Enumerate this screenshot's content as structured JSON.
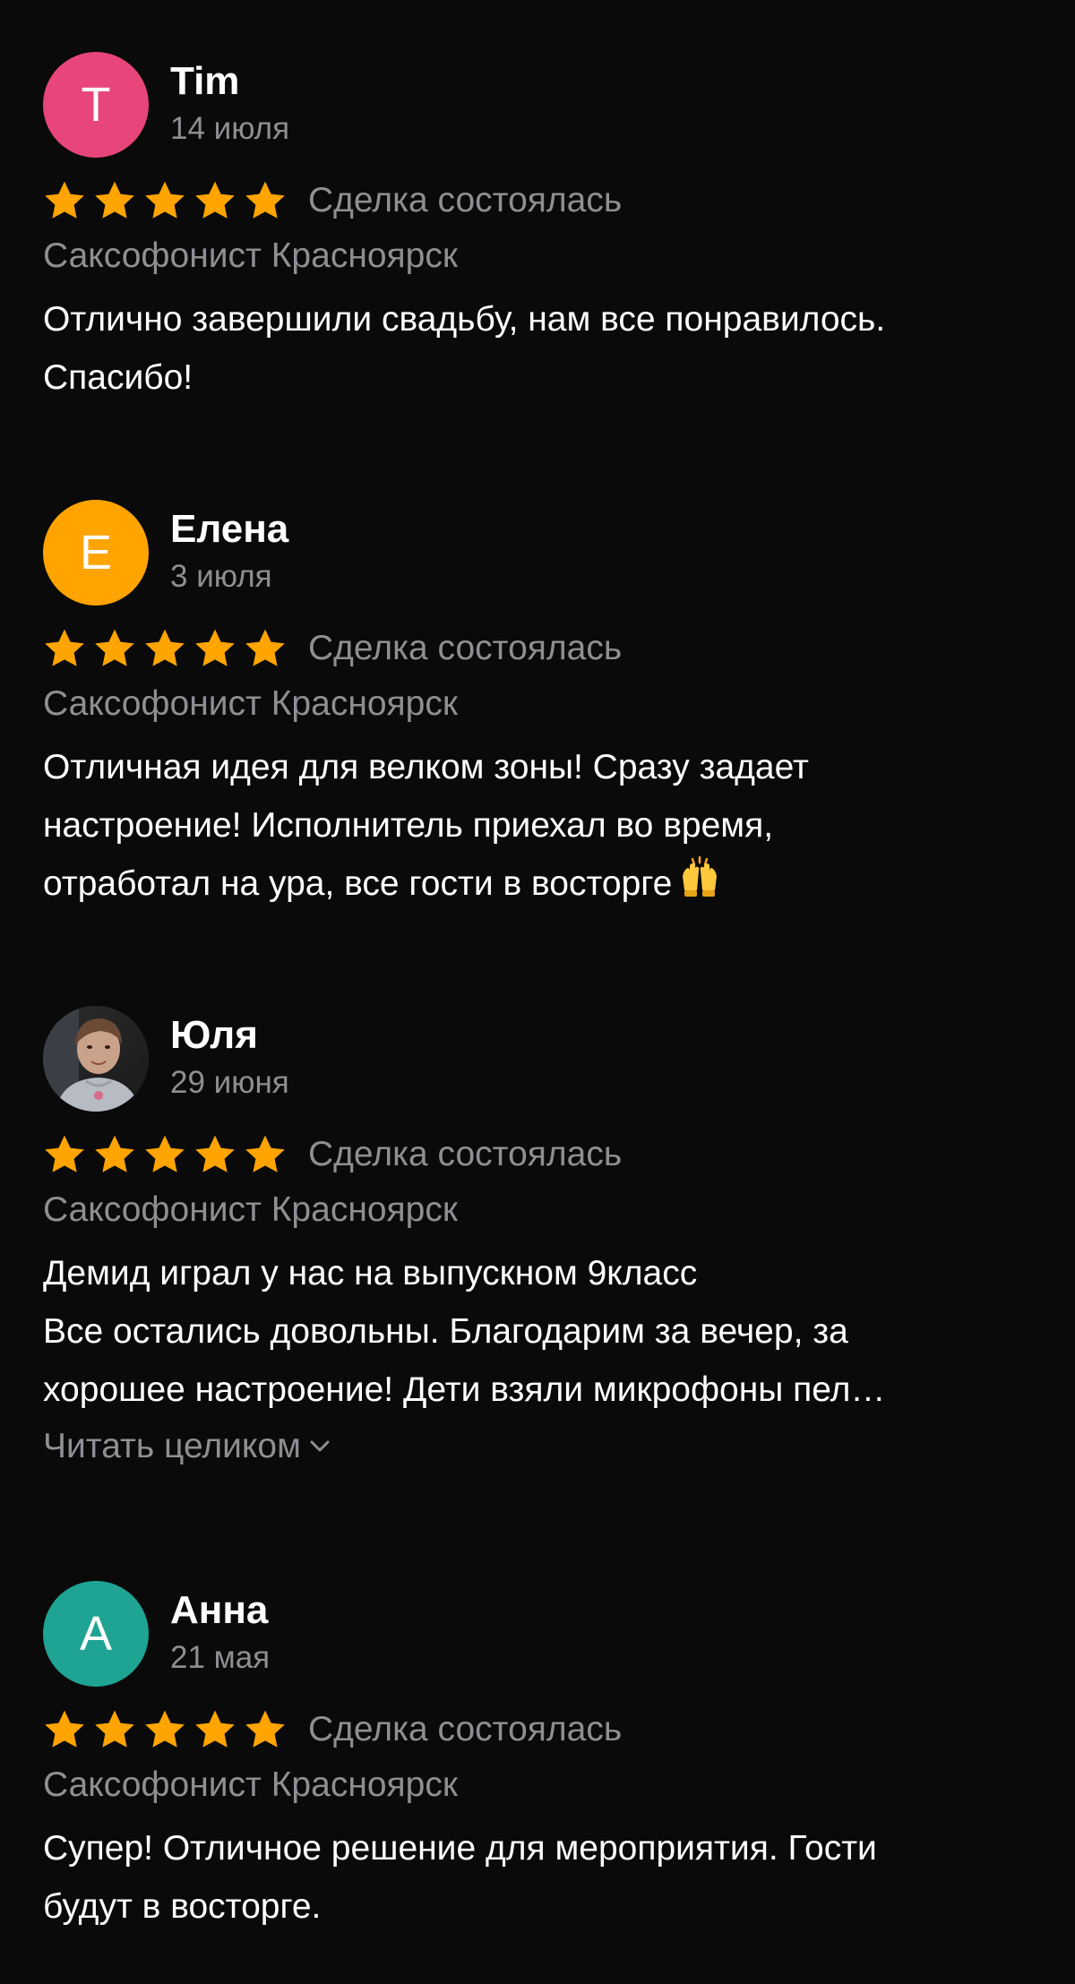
{
  "reviews": [
    {
      "initial": "T",
      "avatar_color": "#e8457a",
      "name": "Tim",
      "date": "14 июля",
      "rating": 5,
      "deal_status": "Сделка состоялась",
      "service": "Саксофонист Красноярск",
      "text": "Отлично завершили свадьбу, нам все понравилось.\nСпасибо!"
    },
    {
      "initial": "Е",
      "avatar_color": "#ffa400",
      "name": "Елена",
      "date": "3 июля",
      "rating": 5,
      "deal_status": "Сделка состоялась",
      "service": "Саксофонист Красноярск",
      "text": "Отличная идея для велком зоны! Сразу задает\nнастроение! Исполнитель приехал во время,\nотработал на ура, все гости в восторге",
      "text_emoji": "raising-hands-icon"
    },
    {
      "avatar_type": "photo",
      "name": "Юля",
      "date": "29 июня",
      "rating": 5,
      "deal_status": "Сделка состоялась",
      "service": "Саксофонист Красноярск",
      "text": "Демид играл у нас на выпускном  9класс\nВсе остались довольны. Благодарим за вечер, за\nхорошее настроение! Дети взяли микрофоны пел…",
      "read_more": "Читать целиком"
    },
    {
      "initial": "А",
      "avatar_color": "#1fa393",
      "name": "Анна",
      "date": "21 мая",
      "rating": 5,
      "deal_status": "Сделка состоялась",
      "service": "Саксофонист Красноярск",
      "text": "Супер! Отличное решение для мероприятия. Гости\nбудут в восторге."
    }
  ],
  "colors": {
    "background": "#0a0a0a",
    "star": "#ffa400",
    "secondary_text": "#8e8e93"
  }
}
